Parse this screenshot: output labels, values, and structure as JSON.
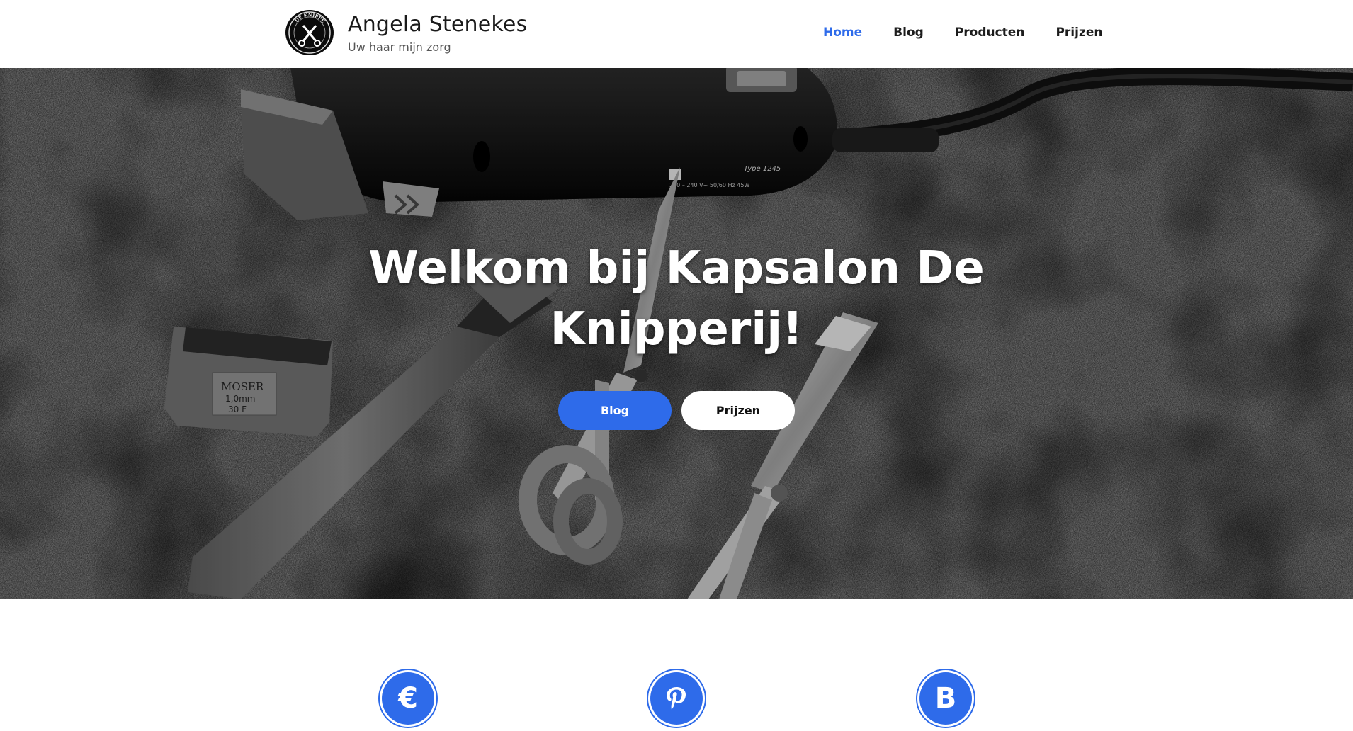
{
  "header": {
    "site_title": "Angela Stenekes",
    "tagline": "Uw haar mijn zorg",
    "logo_text": "DE KNIPPERIJ",
    "nav": [
      {
        "label": "Home",
        "active": true
      },
      {
        "label": "Blog",
        "active": false
      },
      {
        "label": "Producten",
        "active": false
      },
      {
        "label": "Prijzen",
        "active": false
      }
    ]
  },
  "hero": {
    "title": "Welkom bij Kapsalon De Knipperij!",
    "buttons": {
      "primary": "Blog",
      "secondary": "Prijzen"
    },
    "image_labels": {
      "clipper_type": "Type 1245",
      "clipper_spec": "220 – 240 V~ 50/60 Hz 45W",
      "blade_brand": "MOSER",
      "blade_size": "1,0mm",
      "blade_code": "30 F"
    }
  },
  "features": [
    {
      "icon": "euro-icon",
      "glyph": "€"
    },
    {
      "icon": "pinterest-icon",
      "glyph": "P"
    },
    {
      "icon": "bootstrap-icon",
      "glyph": "B"
    }
  ],
  "colors": {
    "accent": "#2e6bea",
    "header_bg": "#ffffff",
    "text_dark": "#1c1c1c"
  }
}
